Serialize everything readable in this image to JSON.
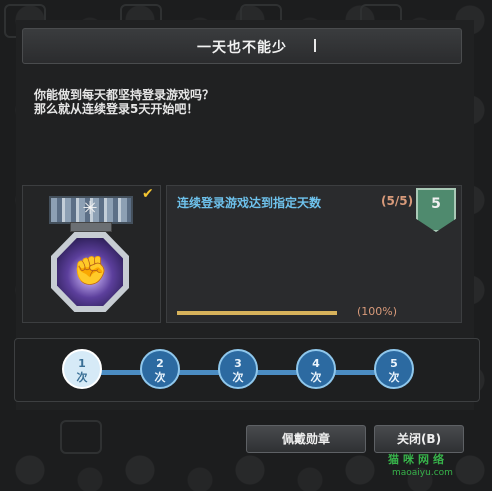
{
  "dialog": {
    "title": "一天也不能少",
    "description_line1": "你能做到每天都坚持登录游戏吗？",
    "description_line2": "那么就从连续登录5天开始吧！"
  },
  "task": {
    "text": "连续登录游戏达到指定天数",
    "progress_text": "(5/5)",
    "level": "5",
    "percent_text": "(100%)",
    "progress_fraction": 1.0,
    "completed": true
  },
  "steps": [
    {
      "num": "1",
      "unit": "次",
      "active": true
    },
    {
      "num": "2",
      "unit": "次",
      "active": false
    },
    {
      "num": "3",
      "unit": "次",
      "active": false
    },
    {
      "num": "4",
      "unit": "次",
      "active": false
    },
    {
      "num": "5",
      "unit": "次",
      "active": false
    }
  ],
  "buttons": {
    "wear_medal": "佩戴勋章",
    "close": "关闭(B)"
  },
  "watermark": {
    "line1": "猫咪网络",
    "line2": "maoaiyu.com"
  },
  "colors": {
    "task_text": "#6ec2ec",
    "progress_text": "#d89a7a",
    "bar_fill": "#d7b25b",
    "step_blue": "#2c6aa1"
  },
  "icons": {
    "medal": "fist-medal-icon",
    "complete_check": "check-icon",
    "level_badge": "shield-badge-icon"
  }
}
